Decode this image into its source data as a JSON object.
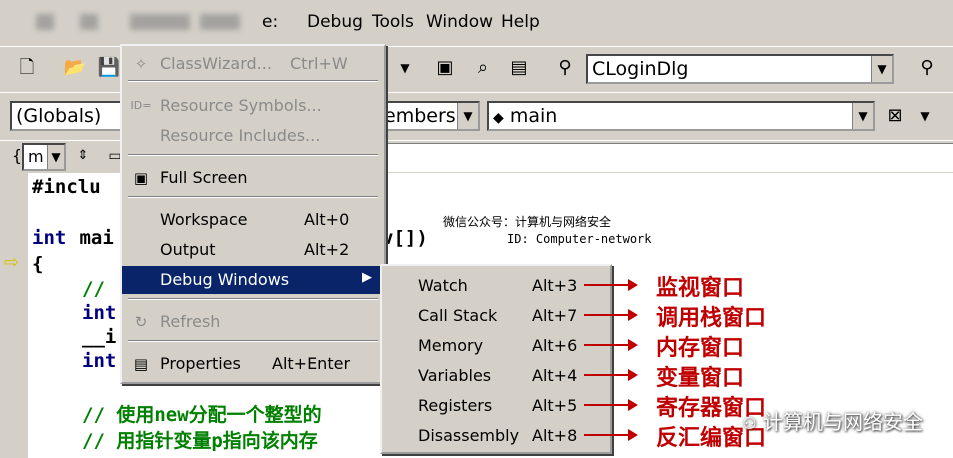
{
  "menubar": {
    "items": [
      "Debug",
      "Tools",
      "Window",
      "Help"
    ],
    "partial": "e:"
  },
  "toolbar": {
    "class_combo": "CLoginDlg"
  },
  "wizardbar": {
    "scope": "(Globals)",
    "members": "embers",
    "function": "main"
  },
  "codebar": {
    "indicator": "m"
  },
  "code": {
    "line1": "#inclu",
    "line2_kw": "int",
    "line2_rest": " mai",
    "line2_tail": "v[])",
    "brace": "{",
    "l4": "//",
    "l5": "int",
    "l6": "__i",
    "l7": "int",
    "c1": "// 使用new分配一个整型的",
    "c2": "// 用指针变量p指向该内存"
  },
  "watermark": {
    "line1": "微信公众号：计算机与网络安全",
    "line2": "ID: Computer-network"
  },
  "view_menu": {
    "items": [
      {
        "label": "ClassWizard...",
        "shortcut": "Ctrl+W"
      },
      {
        "label": "Resource Symbols..."
      },
      {
        "label": "Resource Includes..."
      },
      {
        "label": "Full Screen"
      },
      {
        "label": "Workspace",
        "shortcut": "Alt+0"
      },
      {
        "label": "Output",
        "shortcut": "Alt+2"
      },
      {
        "label": "Debug Windows",
        "submenu_arrow": "▶"
      },
      {
        "label": "Refresh"
      },
      {
        "label": "Properties",
        "shortcut": "Alt+Enter"
      }
    ]
  },
  "debug_windows_menu": {
    "items": [
      {
        "label": "Watch",
        "shortcut": "Alt+3",
        "note": "监视窗口"
      },
      {
        "label": "Call Stack",
        "shortcut": "Alt+7",
        "note": "调用栈窗口"
      },
      {
        "label": "Memory",
        "shortcut": "Alt+6",
        "note": "内存窗口"
      },
      {
        "label": "Variables",
        "shortcut": "Alt+4",
        "note": "变量窗口"
      },
      {
        "label": "Registers",
        "shortcut": "Alt+5",
        "note": "寄存器窗口"
      },
      {
        "label": "Disassembly",
        "shortcut": "Alt+8",
        "note": "反汇编窗口"
      }
    ]
  },
  "brand": "计算机与网络安全",
  "colors": {
    "accent": "#c00000",
    "selection": "#0a246a"
  }
}
